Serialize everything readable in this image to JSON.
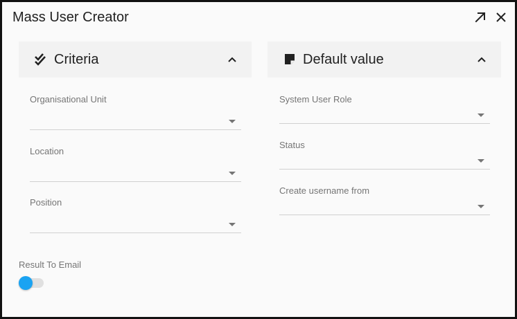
{
  "window": {
    "title": "Mass User Creator",
    "actions": [
      {
        "icon": "expand-icon"
      },
      {
        "icon": "close-icon"
      }
    ]
  },
  "criteria": {
    "title": "Criteria",
    "icon": "double-check-icon",
    "toggle_icon": "chevron-up-icon",
    "fields": [
      {
        "label": "Organisational Unit",
        "value": ""
      },
      {
        "label": "Location",
        "value": ""
      },
      {
        "label": "Position",
        "value": ""
      }
    ]
  },
  "default_value": {
    "title": "Default value",
    "icon": "note-icon",
    "toggle_icon": "chevron-up-icon",
    "fields": [
      {
        "label": "System User Role",
        "value": ""
      },
      {
        "label": "Status",
        "value": ""
      },
      {
        "label": "Create username from",
        "value": ""
      }
    ]
  },
  "result_to_email": {
    "label": "Result To Email",
    "enabled": false
  },
  "colors": {
    "accent": "#1aa3f2",
    "background": "#fafafa",
    "panel_header": "#f2f2f2",
    "border": "#111111"
  }
}
